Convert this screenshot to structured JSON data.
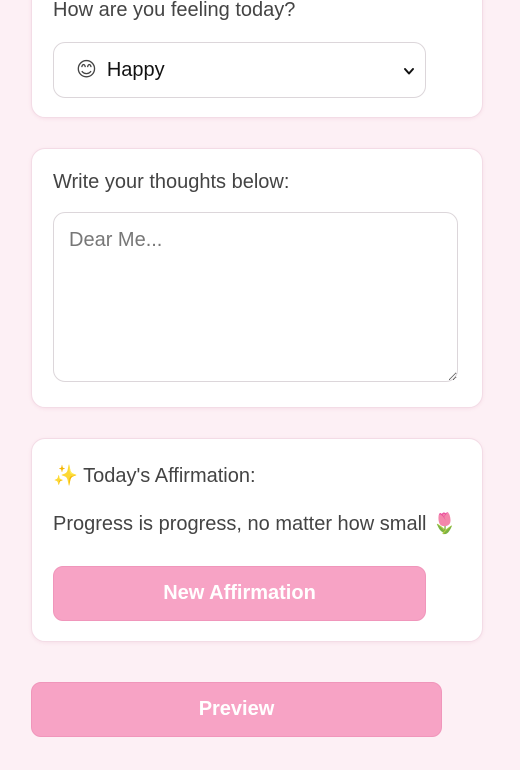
{
  "mood": {
    "label": "How are you feeling today?",
    "selected_emoji": "😊",
    "selected_value": "Happy"
  },
  "thoughts": {
    "label": "Write your thoughts below:",
    "placeholder": "Dear Me...",
    "value": ""
  },
  "affirmation": {
    "heading_icon": "✨",
    "heading": "Today's Affirmation:",
    "text": "Progress is progress, no matter how small",
    "text_icon": "🌷",
    "button_label": "New Affirmation"
  },
  "preview": {
    "button_label": "Preview"
  },
  "colors": {
    "background": "#fdf0f5",
    "button_pink": "#f7a3c5",
    "card_border": "#f3dce6"
  }
}
